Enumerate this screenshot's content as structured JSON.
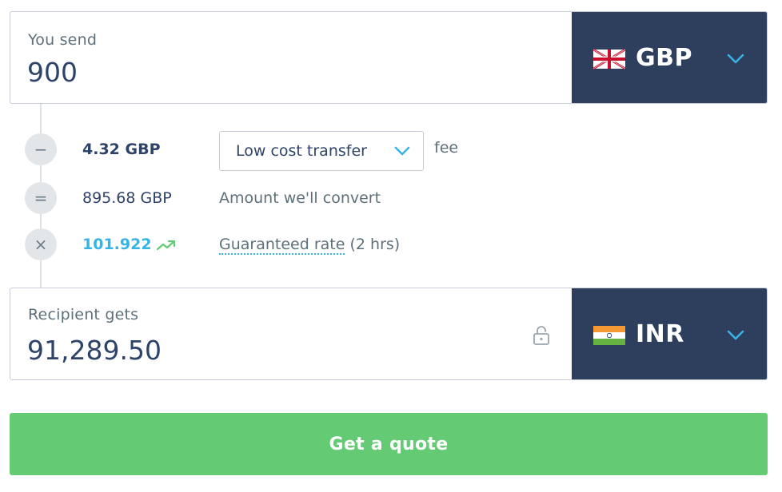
{
  "send": {
    "label": "You send",
    "amount": "900",
    "currency": "GBP",
    "flag_icon": "uk-flag-icon"
  },
  "breakdown": {
    "fee": {
      "operator": "−",
      "amount": "4.32 GBP",
      "transfer_type": "Low cost transfer",
      "suffix": "fee"
    },
    "convert": {
      "operator": "=",
      "amount": "895.68 GBP",
      "description": "Amount we'll convert"
    },
    "rate": {
      "operator": "×",
      "value": "101.922",
      "trend_icon": "trending-up-icon",
      "link_text": "Guaranteed rate",
      "duration": "(2 hrs)"
    }
  },
  "receive": {
    "label": "Recipient gets",
    "amount": "91,289.50",
    "currency": "INR",
    "flag_icon": "india-flag-icon",
    "lock_icon": "lock-open-icon"
  },
  "cta": {
    "label": "Get a quote"
  },
  "colors": {
    "navy": "#2e3f5e",
    "accent_blue": "#37b4e6",
    "green": "#65ca74",
    "text_dark": "#2e4369",
    "text_muted": "#5d7079"
  }
}
